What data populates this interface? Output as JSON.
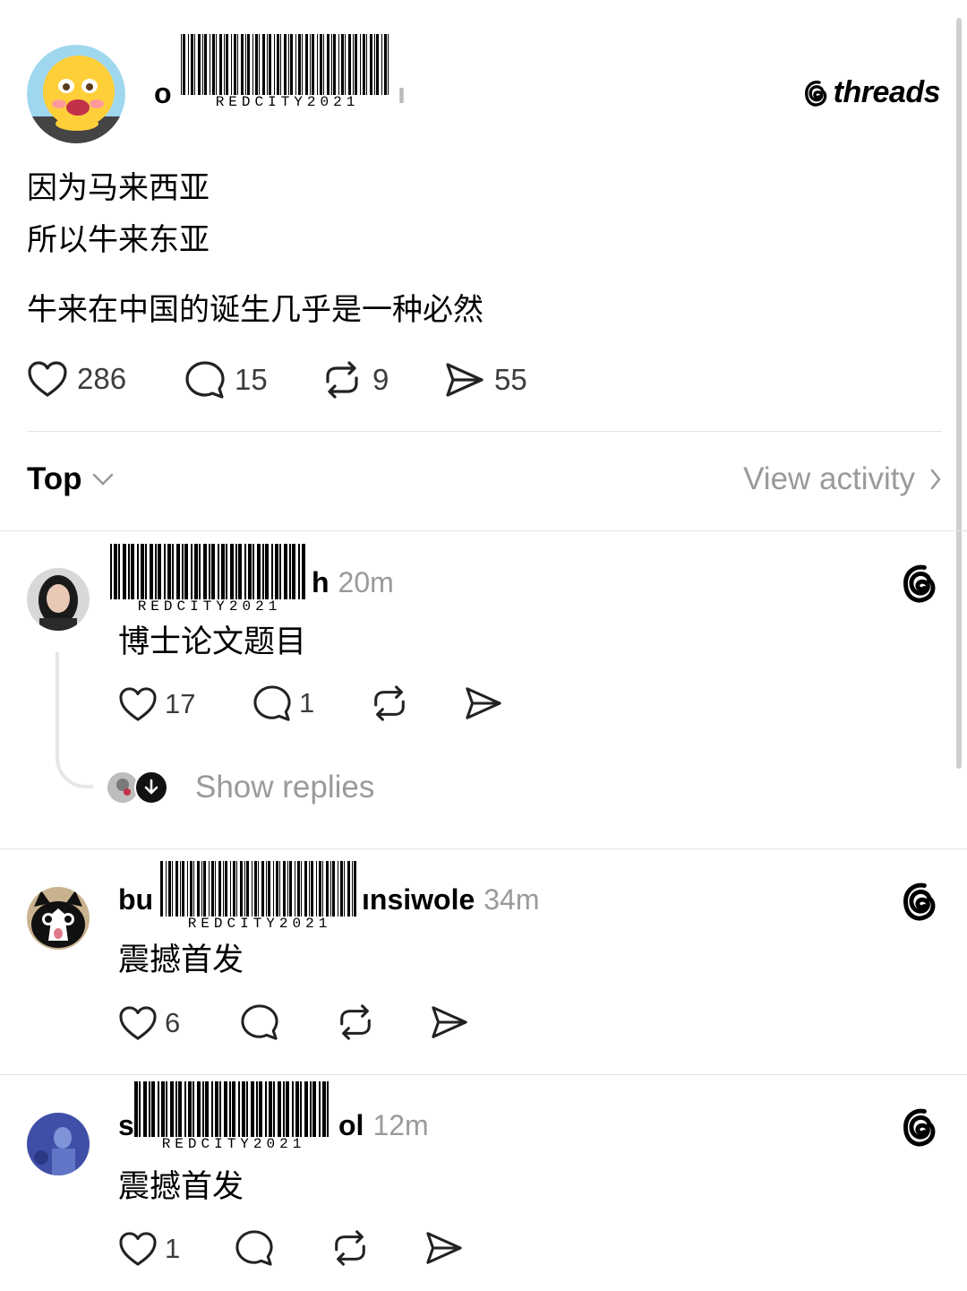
{
  "post": {
    "author_fragment_start": "o",
    "author_fragment_end": "ı",
    "brand": "threads",
    "lines": [
      "因为马来西亚",
      "所以牛来东亚",
      "牛来在中国的诞生几乎是一种必然"
    ],
    "likes": "286",
    "replies": "15",
    "reposts": "9",
    "shares": "55"
  },
  "watermark": "REDCITY2021",
  "sort": {
    "label": "Top",
    "activity": "View activity"
  },
  "comments": [
    {
      "name_start": "",
      "name_end": "h",
      "time": "20m",
      "text": "博士论文题目",
      "likes": "17",
      "replies": "1",
      "show_replies": "Show replies"
    },
    {
      "name_start": "bu",
      "name_end": "ınsiwole",
      "time": "34m",
      "text": "震撼首发",
      "likes": "6"
    },
    {
      "name_start": "s",
      "name_end": "ol",
      "time": "12m",
      "text": "震撼首发",
      "likes": "1"
    }
  ],
  "colors": {
    "text": "#000000",
    "muted": "#9a9a9a",
    "divider": "#e3e3e3"
  }
}
